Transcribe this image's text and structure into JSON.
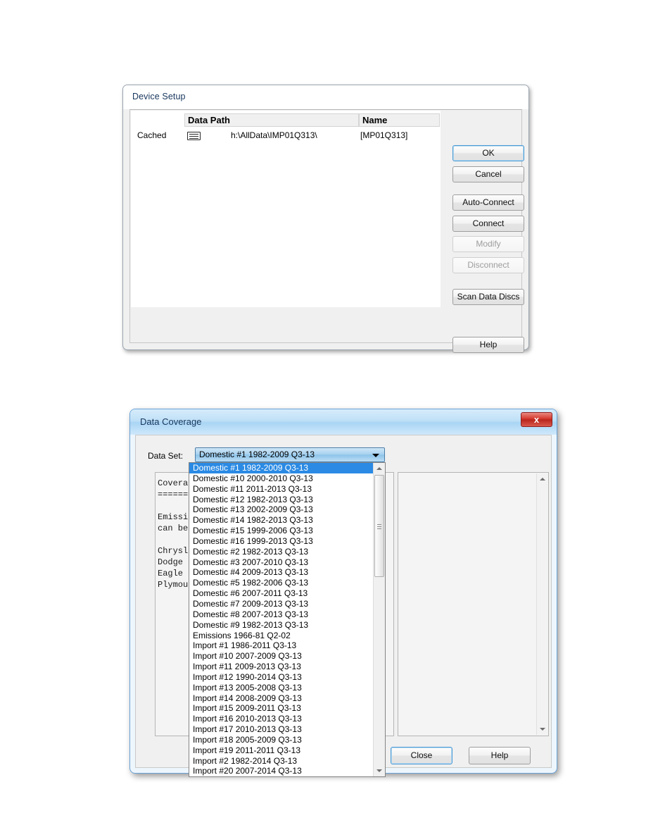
{
  "device_setup": {
    "title": "Device Setup",
    "columns": [
      "Data Path",
      "Name"
    ],
    "rows": [
      {
        "status": "Cached",
        "icon": "disk-drive-icon",
        "path": "h:\\AllData\\IMP01Q313\\",
        "name": "[MP01Q313]"
      }
    ],
    "buttons": {
      "ok": "OK",
      "cancel": "Cancel",
      "auto_connect": "Auto-Connect",
      "connect": "Connect",
      "modify": "Modify",
      "disconnect": "Disconnect",
      "scan_data_discs": "Scan Data Discs",
      "help": "Help"
    }
  },
  "data_coverage": {
    "title": "Data Coverage",
    "close_glyph": "x",
    "dataset_label": "Data Set:",
    "selected_dataset": "Domestic #1 1982-2009 Q3-13",
    "coverage_text_lines": [
      "Coverag",
      "=======",
      "",
      "Emissio",
      "can be",
      "",
      "Chrysle",
      "Dodge",
      "Eagle",
      "Plymout"
    ],
    "dropdown_options": [
      "Domestic #1 1982-2009 Q3-13",
      "Domestic #10 2000-2010 Q3-13",
      "Domestic #11 2011-2013 Q3-13",
      "Domestic #12 1982-2013 Q3-13",
      "Domestic #13 2002-2009 Q3-13",
      "Domestic #14 1982-2013 Q3-13",
      "Domestic #15 1999-2006 Q3-13",
      "Domestic #16 1999-2013 Q3-13",
      "Domestic #2 1982-2013 Q3-13",
      "Domestic #3 2007-2010 Q3-13",
      "Domestic #4 2009-2013 Q3-13",
      "Domestic #5 1982-2006 Q3-13",
      "Domestic #6 2007-2011 Q3-13",
      "Domestic #7 2009-2013 Q3-13",
      "Domestic #8 2007-2013 Q3-13",
      "Domestic #9 1982-2013 Q3-13",
      "Emissions 1966-81 Q2-02",
      "Import #1 1986-2011 Q3-13",
      "Import #10 2007-2009 Q3-13",
      "Import #11 2009-2013 Q3-13",
      "Import #12 1990-2014 Q3-13",
      "Import #13 2005-2008 Q3-13",
      "Import #14 2008-2009 Q3-13",
      "Import #15 2009-2011 Q3-13",
      "Import #16 2010-2013 Q3-13",
      "Import #17 2010-2013 Q3-13",
      "Import #18 2005-2009 Q3-13",
      "Import #19 2011-2011 Q3-13",
      "Import #2 1982-2014 Q3-13",
      "Import #20 2007-2014 Q3-13"
    ],
    "selected_index": 0,
    "buttons": {
      "close": "Close",
      "help": "Help"
    }
  },
  "colors": {
    "selection_blue": "#2a8ae4",
    "title_navy": "#17365d",
    "close_red": "#d4372c",
    "focus_border": "#4a9ad4"
  }
}
